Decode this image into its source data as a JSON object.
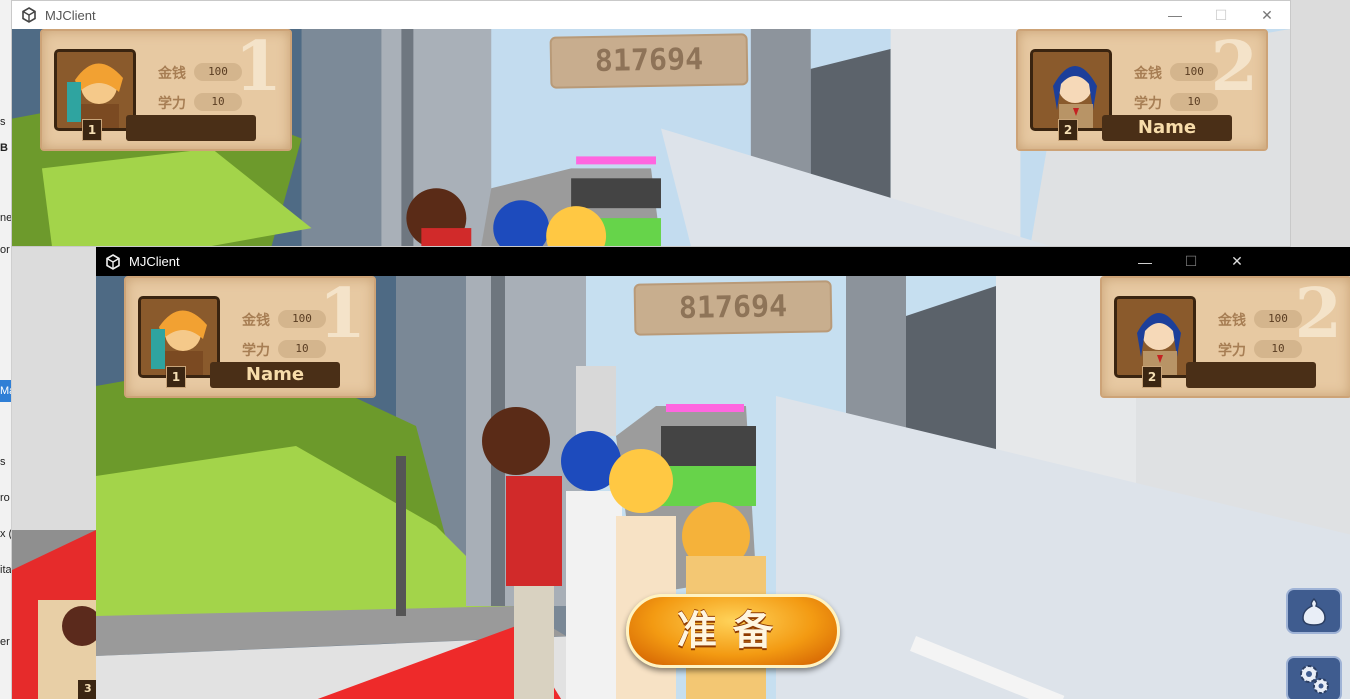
{
  "background_app": {
    "fragments": [
      "s",
      "B",
      "ne",
      "or",
      "Ma",
      "s",
      "ro",
      "x (",
      "ita",
      "er"
    ]
  },
  "windows": [
    {
      "title": "MJClient",
      "controls": {
        "minimize": "—",
        "maximize": "☐",
        "close": "✕"
      },
      "hud": {
        "score": "817694",
        "players": [
          {
            "number": "1",
            "level": "1",
            "money_label": "金钱",
            "money": "100",
            "study_label": "学力",
            "study": "10",
            "name": ""
          },
          {
            "number": "2",
            "level": "2",
            "money_label": "金钱",
            "money": "100",
            "study_label": "学力",
            "study": "10",
            "name": "Name"
          }
        ]
      }
    },
    {
      "title": "MJClient",
      "controls": {
        "minimize": "—",
        "maximize": "☐",
        "close": "✕"
      },
      "hud": {
        "score": "817694",
        "players": [
          {
            "number": "1",
            "level": "1",
            "money_label": "金钱",
            "money": "100",
            "study_label": "学力",
            "study": "10",
            "name": "Name"
          },
          {
            "number": "2",
            "level": "2",
            "money_label": "金钱",
            "money": "100",
            "study_label": "学力",
            "study": "10",
            "name": ""
          }
        ],
        "ready_button": "准备",
        "bag_icon": "bag-icon",
        "settings_icon": "gear-icon",
        "corner_badge": "3"
      }
    }
  ]
}
